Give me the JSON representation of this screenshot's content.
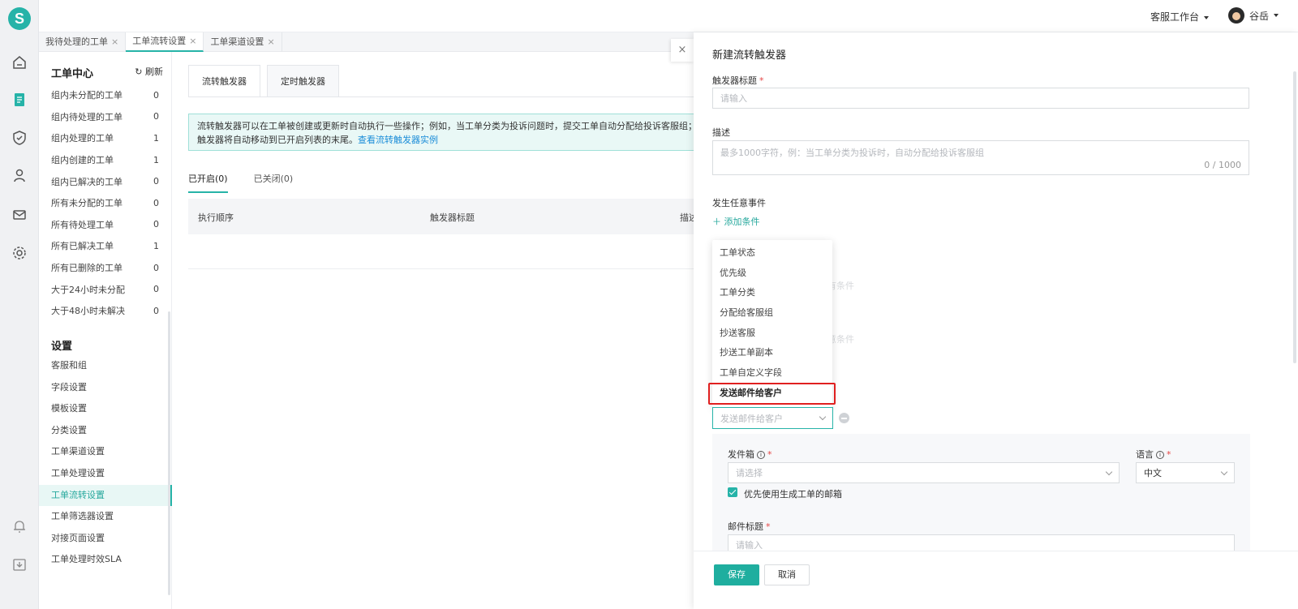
{
  "topbar": {
    "workbench": "客服工作台",
    "user_name": "谷岳"
  },
  "tabs": [
    {
      "label": "我待处理的工单",
      "close": "×"
    },
    {
      "label": "工单流转设置",
      "close": "×"
    },
    {
      "label": "工单渠道设置",
      "close": "×"
    }
  ],
  "sidebar": {
    "title": "工单中心",
    "refresh_label": "刷新",
    "items": [
      {
        "label": "组内未分配的工单",
        "count": "0"
      },
      {
        "label": "组内待处理的工单",
        "count": "0"
      },
      {
        "label": "组内处理的工单",
        "count": "1"
      },
      {
        "label": "组内创建的工单",
        "count": "1"
      },
      {
        "label": "组内已解决的工单",
        "count": "0"
      },
      {
        "label": "所有未分配的工单",
        "count": "0"
      },
      {
        "label": "所有待处理工单",
        "count": "0"
      },
      {
        "label": "所有已解决工单",
        "count": "1"
      },
      {
        "label": "所有已删除的工单",
        "count": "0"
      },
      {
        "label": "大于24小时未分配",
        "count": "0"
      },
      {
        "label": "大于48小时未解决",
        "count": "0"
      }
    ],
    "settings_title": "设置",
    "settings": [
      "客服和组",
      "字段设置",
      "模板设置",
      "分类设置",
      "工单渠道设置",
      "工单处理设置",
      "工单流转设置",
      "工单筛选器设置",
      "对接页面设置",
      "工单处理时效SLA"
    ]
  },
  "main": {
    "subtabs": [
      "流转触发器",
      "定时触发器"
    ],
    "info_text": "流转触发器可以在工单被创建或更新时自动执行一些操作；例如，当工单分类为投诉问题时，提交工单自动分配给投诉客服组；",
    "info_text2": "触发器将自动移动到已开启列表的末尾。",
    "info_link": "查看流转触发器实例",
    "open_tab": "已开启(0)",
    "closed_tab": "已关闭(0)",
    "columns": [
      "执行顺序",
      "触发器标题",
      "描述"
    ]
  },
  "drawer": {
    "close": "×",
    "title": "新建流转触发器",
    "trigger_title_label": "触发器标题",
    "trigger_title_placeholder": "请输入",
    "desc_label": "描述",
    "desc_placeholder": "最多1000字符，例：当工单分类为投诉时，自动分配给投诉客服组",
    "desc_counter": "0 / 1000",
    "event_label": "发生任意事件",
    "add_condition": "添加条件",
    "ghost_1": "满足以下所有条件",
    "ghost_2": "满足以下任意条件",
    "dropdown": [
      "工单状态",
      "优先级",
      "工单分类",
      "分配给客服组",
      "抄送客服",
      "抄送工单副本",
      "工单自定义字段",
      "发送邮件给客户"
    ],
    "action_selected": "发送邮件给客户",
    "mailbox_label": "发件箱",
    "mailbox_placeholder": "请选择",
    "language_label": "语言",
    "language_value": "中文",
    "prefer_mailbox": "优先使用生成工单的邮箱",
    "mail_title_label": "邮件标题",
    "mail_title_placeholder": "请输入",
    "save": "保存",
    "cancel": "取消"
  }
}
